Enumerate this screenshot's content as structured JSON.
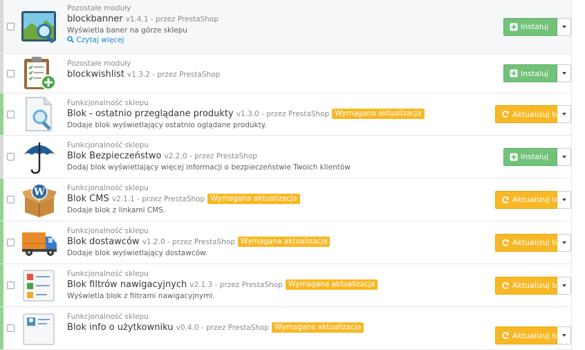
{
  "modules": [
    {
      "category": "Pozostałe moduły",
      "name": "blockbanner",
      "version": "v1.4.1 - przez PrestaShop",
      "badge": "",
      "description": "Wyświetla baner na górze sklepu",
      "more": "Czytaj więcej",
      "action": "Instaluj",
      "icon": "banner-icon",
      "status": "install"
    },
    {
      "category": "Pozostałe moduły",
      "name": "blockwishlist",
      "version": "v1.3.2 - przez PrestaShop",
      "badge": "",
      "description": "",
      "more": "",
      "action": "Instaluj",
      "icon": "wishlist-clipboard-icon",
      "status": "install"
    },
    {
      "category": "Funkcjonalność sklepu",
      "name": "Blok - ostatnio przeglądane produkty",
      "version": "v1.3.0 - przez PrestaShop",
      "badge": "Wymagana aktualizacja",
      "description": "Dodaje blok wyświetlający ostatnio oglądane produkty.",
      "more": "",
      "action": "Aktualizuj tol",
      "icon": "viewed-products-icon",
      "status": "update"
    },
    {
      "category": "Funkcjonalność sklepu",
      "name": "Blok Bezpieczeństwo",
      "version": "v2.2.0 - przez PrestaShop",
      "badge": "",
      "description": "Dodaj blok wyświetlający więcej informacji o bezpieczeństwie Twoich klientów",
      "more": "",
      "action": "Instaluj",
      "icon": "umbrella-icon",
      "status": "install"
    },
    {
      "category": "Funkcjonalność sklepu",
      "name": "Blok CMS",
      "version": "v2.1.1 - przez PrestaShop",
      "badge": "Wymagana aktualizacja",
      "description": "Dodaje blok z linkami CMS.",
      "more": "",
      "action": "Aktualizuj tol",
      "icon": "wordpress-box-icon",
      "status": "update"
    },
    {
      "category": "Funkcjonalność sklepu",
      "name": "Blok dostawców",
      "version": "v1.2.0 - przez PrestaShop",
      "badge": "Wymagana aktualizacja",
      "description": "Dodaje blok wyświetlający dostawców.",
      "more": "",
      "action": "Aktualizuj tol",
      "icon": "delivery-truck-icon",
      "status": "update"
    },
    {
      "category": "Funkcjonalność sklepu",
      "name": "Blok filtrów nawigacyjnych",
      "version": "v2.1.3 - przez PrestaShop",
      "badge": "Wymagana aktualizacja",
      "description": "Wyświetla blok z filtrami nawigacyjnymi.",
      "more": "",
      "action": "Aktualizuj tol",
      "icon": "filter-list-icon",
      "status": "update"
    },
    {
      "category": "Funkcjonalność sklepu",
      "name": "Blok info o użytkowniku",
      "version": "v0.4.0 - przez PrestaShop",
      "badge": "Wymagana aktualizacja",
      "description": "",
      "more": "",
      "action": "Aktualizuj tol",
      "icon": "user-info-icon",
      "status": "update"
    }
  ],
  "colors": {
    "install": "#72c279",
    "update": "#f8b826",
    "link": "#1f8cd6"
  }
}
